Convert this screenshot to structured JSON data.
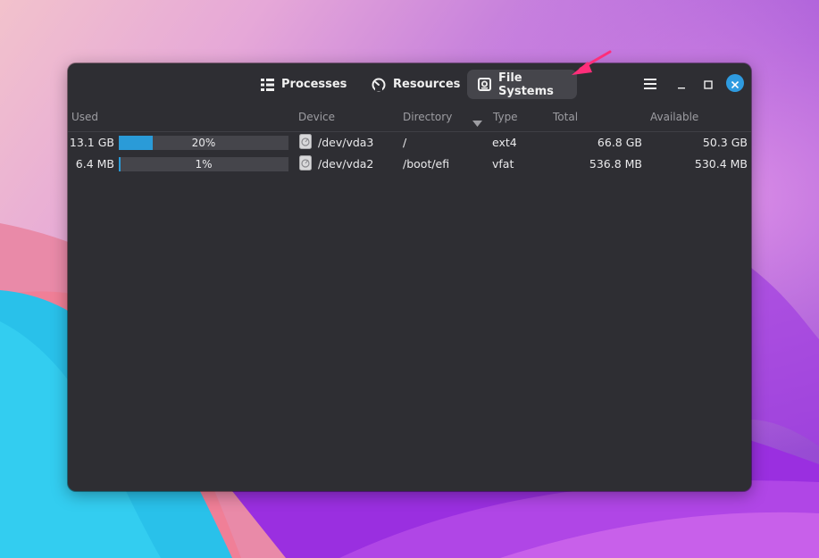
{
  "tabs": [
    {
      "label": "Processes",
      "icon": "list-icon"
    },
    {
      "label": "Resources",
      "icon": "gauge-icon"
    },
    {
      "label": "File Systems",
      "icon": "disk-icon",
      "active": true
    }
  ],
  "columns": {
    "used": "Used",
    "device": "Device",
    "directory": "Directory",
    "type": "Type",
    "total": "Total",
    "available": "Available"
  },
  "rows": [
    {
      "used": "13.1 GB",
      "percent_label": "20%",
      "percent": 20,
      "device": "/dev/vda3",
      "directory": "/",
      "type": "ext4",
      "total": "66.8 GB",
      "available": "50.3 GB"
    },
    {
      "used": "6.4 MB",
      "percent_label": "1%",
      "percent": 1,
      "device": "/dev/vda2",
      "directory": "/boot/efi",
      "type": "vfat",
      "total": "536.8 MB",
      "available": "530.4 MB"
    }
  ],
  "colors": {
    "accent": "#2a9bd8",
    "close": "#2e9be0",
    "window_bg": "#2e2e33",
    "arrow": "#ff2e7a"
  }
}
